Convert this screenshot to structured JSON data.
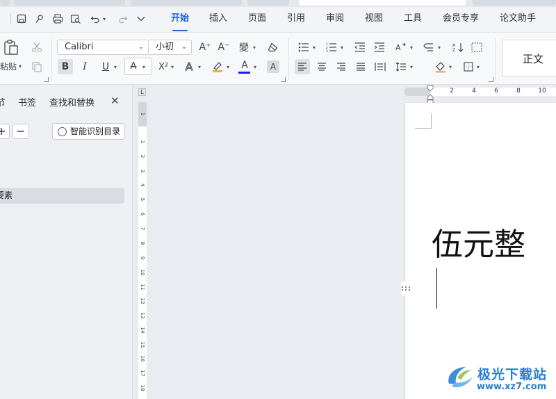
{
  "menubar": {
    "tabs": [
      {
        "label": "开始",
        "active": true
      },
      {
        "label": "插入"
      },
      {
        "label": "页面"
      },
      {
        "label": "引用"
      },
      {
        "label": "审阅"
      },
      {
        "label": "视图"
      },
      {
        "label": "工具"
      },
      {
        "label": "会员专享"
      },
      {
        "label": "论文助手"
      }
    ]
  },
  "ribbon": {
    "paste_label": "粘贴",
    "font_name": "Calibri",
    "font_size": "小初",
    "bold": "B",
    "italic": "I",
    "underline": "U",
    "strikethrough": "A",
    "superscript": "X²",
    "text_effect": "A",
    "font_color": "A",
    "char_shading": "A",
    "grow_font": "A⁺",
    "shrink_font": "A⁻",
    "phonetic": "變",
    "style_name": "正文",
    "font_color_hex": "#1a1aff",
    "highlight_hex": "#e8b54a"
  },
  "navpanel": {
    "tabs": [
      "节",
      "书签",
      "查找和替换"
    ],
    "close_icon": "✕",
    "add_button": "+",
    "remove_button": "−",
    "smart_button": "智能识别目录",
    "item_label": "要素"
  },
  "vruler": {
    "corner": "L",
    "numbers": [
      "1",
      "1",
      "2",
      "3",
      "4",
      "5",
      "6",
      "7",
      "8",
      "9",
      "10",
      "11",
      "12",
      "13",
      "14",
      "15",
      "16",
      "17",
      "18"
    ]
  },
  "hruler": {
    "numbers": [
      "2",
      "4",
      "6",
      "8",
      "10"
    ]
  },
  "document": {
    "text": "伍元整"
  },
  "watermark": {
    "name": "极光下载站",
    "url": "www.xz7.com"
  },
  "colors": {
    "accent": "#1d63d6",
    "watermark": "#2a7fd6"
  }
}
